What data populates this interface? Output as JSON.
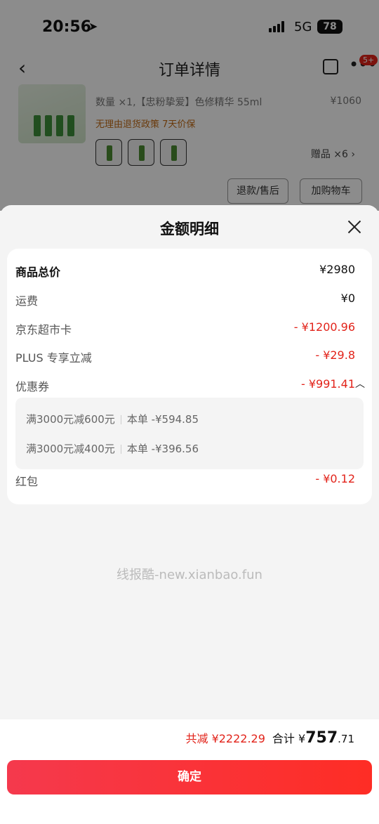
{
  "status": {
    "time": "20:56",
    "network": "5G",
    "battery": "78"
  },
  "nav": {
    "title": "订单详情",
    "badge": "5+"
  },
  "product": {
    "qty_spec": "数量 ×1,【忠粉挚爱】色修精华 55ml",
    "price": "¥1060",
    "policy": "无理由退货政策  7天价保",
    "gift": "赠品 ×6 ›"
  },
  "actions": {
    "refund": "退款/售后",
    "add_cart": "加购物车"
  },
  "sheet": {
    "title": "金额明细"
  },
  "rows": {
    "total": {
      "label": "商品总价",
      "value": "¥2980"
    },
    "shipping": {
      "label": "运费",
      "value": "¥0"
    },
    "card": {
      "label": "京东超市卡",
      "value": "- ¥1200.96"
    },
    "plus": {
      "label": "PLUS 专享立减",
      "value": "- ¥29.8"
    },
    "coupon": {
      "label": "优惠券",
      "value": "- ¥991.41"
    },
    "redpacket": {
      "label": "红包",
      "value": "- ¥0.12"
    }
  },
  "coupons": [
    {
      "rule": "满3000元减600元",
      "deduct": "本单 -¥594.85"
    },
    {
      "rule": "满3000元减400元",
      "deduct": "本单 -¥396.56"
    }
  ],
  "watermark": "线报酷-new.xianbao.fun",
  "footer": {
    "saved": "共减 ¥2222.29",
    "total_label": "合计 ¥",
    "total_int": "757",
    "total_dec": ".71",
    "confirm": "确定"
  },
  "colors": {
    "accent": "#e2231a",
    "button_start": "#f5394d",
    "button_end": "#fe2d25"
  }
}
